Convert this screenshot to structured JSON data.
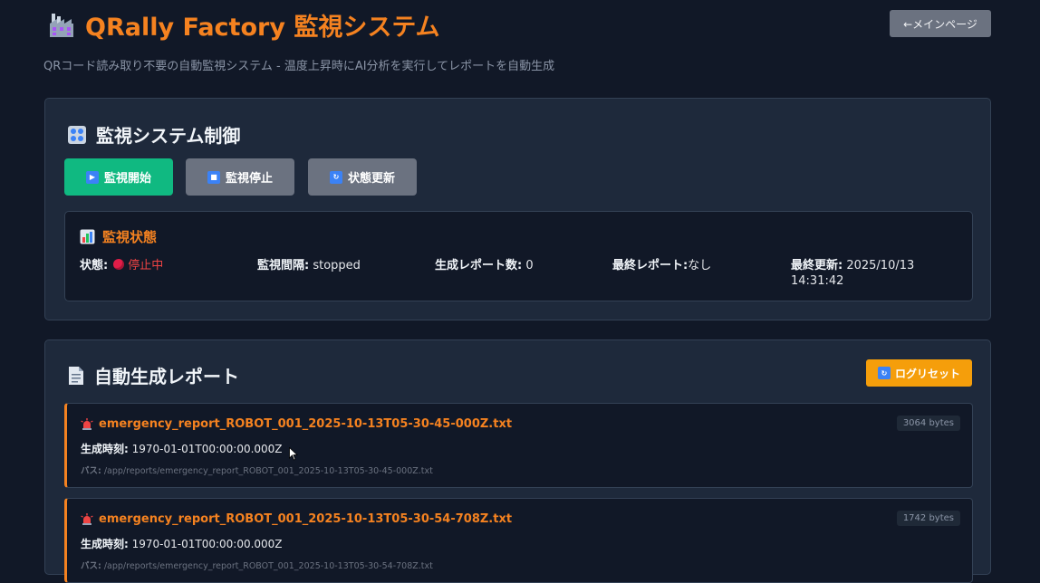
{
  "header": {
    "title": "QRally Factory 監視システム",
    "subtitle": "QRコード読み取り不要の自動監視システム - 温度上昇時にAI分析を実行してレポートを自動生成",
    "main_page_button": "←メインページ",
    "title_icon": "factory-icon"
  },
  "control": {
    "section_title": "監視システム制御",
    "section_icon": "control-knobs-icon",
    "buttons": {
      "start": "監視開始",
      "stop": "監視停止",
      "refresh": "状態更新"
    },
    "status": {
      "title": "監視状態",
      "title_icon": "bar-chart-icon",
      "state_label": "状態:",
      "state_value": "停止中",
      "interval_label": "監視間隔:",
      "interval_value": " stopped",
      "report_count_label": "生成レポート数:",
      "report_count_value": " 0",
      "last_report_label": "最終レポート:",
      "last_report_value": "なし",
      "last_update_label": "最終更新:",
      "last_update_value": " 2025/10/13 14:31:42"
    }
  },
  "reports": {
    "section_title": "自動生成レポート",
    "section_icon": "document-icon",
    "reset_button": "ログリセット",
    "items": [
      {
        "name": "emergency_report_ROBOT_001_2025-10-13T05-30-45-000Z.txt",
        "size": "3064 bytes",
        "time_label": "生成時刻:",
        "time_value": " 1970-01-01T00:00:00.000Z",
        "path_label": "パス:",
        "path_value": " /app/reports/emergency_report_ROBOT_001_2025-10-13T05-30-45-000Z.txt"
      },
      {
        "name": "emergency_report_ROBOT_001_2025-10-13T05-30-54-708Z.txt",
        "size": "1742 bytes",
        "time_label": "生成時刻:",
        "time_value": " 1970-01-01T00:00:00.000Z",
        "path_label": "パス:",
        "path_value": " /app/reports/emergency_report_ROBOT_001_2025-10-13T05-30-54-708Z.txt"
      }
    ]
  },
  "colors": {
    "background": "#111827",
    "panel": "#1e293b",
    "accent_orange": "#f58220",
    "start_green": "#10b981",
    "neutral_button": "#6b7280",
    "reset_amber": "#f59e0b",
    "stopped_red": "#ef4444"
  }
}
